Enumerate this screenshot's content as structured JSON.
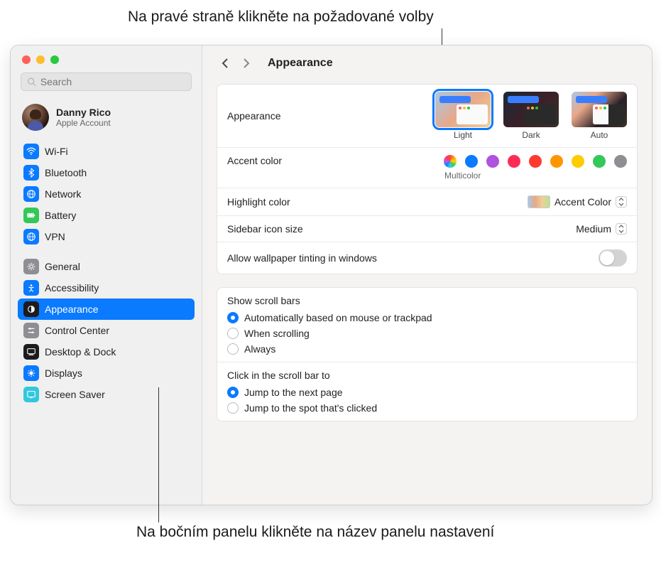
{
  "callouts": {
    "top": "Na pravé straně klikněte na požadované volby",
    "bottom": "Na bočním panelu klikněte na název panelu nastavení"
  },
  "search": {
    "placeholder": "Search"
  },
  "account": {
    "name": "Danny Rico",
    "sub": "Apple Account"
  },
  "sidebar": {
    "group1": [
      {
        "label": "Wi-Fi"
      },
      {
        "label": "Bluetooth"
      },
      {
        "label": "Network"
      },
      {
        "label": "Battery"
      },
      {
        "label": "VPN"
      }
    ],
    "group2": [
      {
        "label": "General"
      },
      {
        "label": "Accessibility"
      },
      {
        "label": "Appearance"
      },
      {
        "label": "Control Center"
      },
      {
        "label": "Desktop & Dock"
      },
      {
        "label": "Displays"
      },
      {
        "label": "Screen Saver"
      }
    ]
  },
  "header": {
    "title": "Appearance"
  },
  "appearance": {
    "label": "Appearance",
    "options": {
      "light": "Light",
      "dark": "Dark",
      "auto": "Auto"
    },
    "selected": "light"
  },
  "accent": {
    "label": "Accent color",
    "sub": "Multicolor",
    "colors": [
      "multicolor",
      "blue",
      "purple",
      "pink",
      "red",
      "orange",
      "yellow",
      "green",
      "gray"
    ]
  },
  "highlight": {
    "label": "Highlight color",
    "value": "Accent Color"
  },
  "sidebarIconSize": {
    "label": "Sidebar icon size",
    "value": "Medium"
  },
  "wallpaperTint": {
    "label": "Allow wallpaper tinting in windows",
    "on": false
  },
  "scrollBars": {
    "label": "Show scroll bars",
    "options": [
      "Automatically based on mouse or trackpad",
      "When scrolling",
      "Always"
    ],
    "selected": 0
  },
  "scrollClick": {
    "label": "Click in the scroll bar to",
    "options": [
      "Jump to the next page",
      "Jump to the spot that's clicked"
    ],
    "selected": 0
  }
}
